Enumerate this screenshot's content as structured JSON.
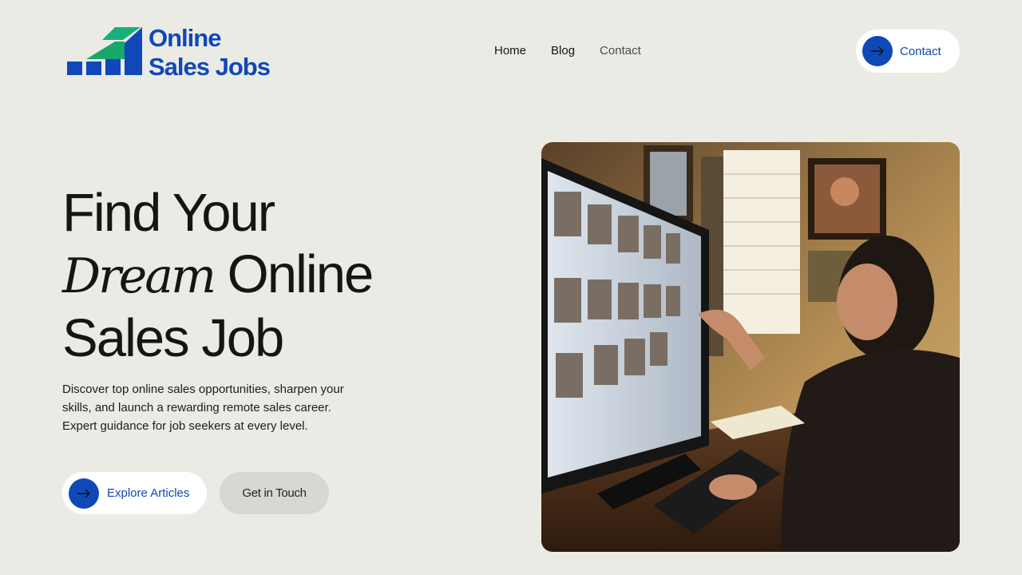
{
  "brand": {
    "line1": "Online",
    "line2": "Sales Jobs",
    "colors": {
      "blue": "#1048b8",
      "green": "#18a86b",
      "teal": "#0aa391"
    }
  },
  "nav": {
    "items": [
      "Home",
      "Blog",
      "Contact"
    ]
  },
  "header": {
    "contact_label": "Contact",
    "contact_icon": "arrow-right-icon"
  },
  "hero": {
    "title_line1": "Find Your",
    "title_line2_italic": "Dream",
    "title_line2_rest": " Online",
    "title_line3": "Sales Job",
    "description": "Discover top online sales opportunities, sharpen your skills, and launch a rewarding remote sales career. Expert guidance for job seekers at every level.",
    "primary_cta": "Explore Articles",
    "secondary_cta": "Get in Touch"
  },
  "colors": {
    "background": "#ebebe5",
    "accent": "#1048b8",
    "button_light": "#ffffff",
    "button_muted": "#d8d8d2"
  }
}
